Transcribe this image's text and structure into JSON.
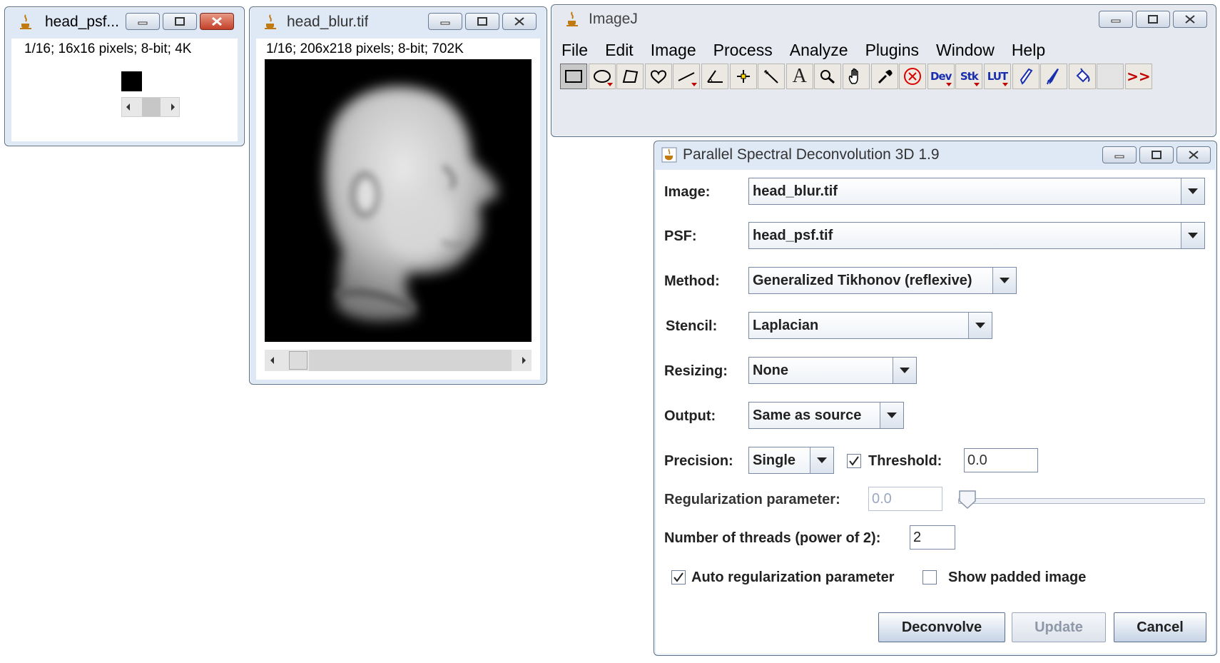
{
  "psf_window": {
    "title": "head_psf...",
    "info": "1/16; 16x16 pixels; 8-bit; 4K"
  },
  "blur_window": {
    "title": "head_blur.tif",
    "info": "1/16; 206x218 pixels; 8-bit; 702K"
  },
  "imagej": {
    "title": "ImageJ",
    "menus": [
      "File",
      "Edit",
      "Image",
      "Process",
      "Analyze",
      "Plugins",
      "Window",
      "Help"
    ],
    "tools": {
      "dev": "Dev",
      "stk": "Stk",
      "lut": "LUT",
      "text": "A",
      "more": ">>"
    }
  },
  "dialog": {
    "title": "Parallel Spectral Deconvolution 3D 1.9",
    "image_label": "Image:",
    "image_value": "head_blur.tif",
    "psf_label": "PSF:",
    "psf_value": "head_psf.tif",
    "method_label": "Method:",
    "method_value": "Generalized Tikhonov (reflexive)",
    "stencil_label": "Stencil:",
    "stencil_value": "Laplacian",
    "resizing_label": "Resizing:",
    "resizing_value": "None",
    "output_label": "Output:",
    "output_value": "Same as source",
    "precision_label": "Precision:",
    "precision_value": "Single",
    "threshold_label": "Threshold:",
    "threshold_checked": true,
    "threshold_value": "0.0",
    "reg_label": "Regularization parameter:",
    "reg_value": "0.0",
    "reg_slider_level": 0,
    "threads_label": "Number of threads (power of 2):",
    "threads_value": "2",
    "auto_reg_label": "Auto regularization parameter",
    "auto_reg_checked": true,
    "show_padded_label": "Show padded image",
    "show_padded_checked": false,
    "deconvolve_label": "Deconvolve",
    "update_label": "Update",
    "cancel_label": "Cancel"
  }
}
